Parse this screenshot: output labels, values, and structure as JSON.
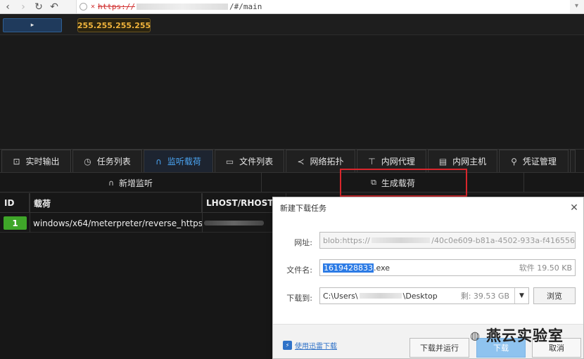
{
  "browser": {
    "back_icon": "chevron-left",
    "forward_icon": "chevron-right",
    "reload_icon": "reload",
    "undo_icon": "undo",
    "add_tab_icon": "plus",
    "warning_icon": "broken-lock",
    "url_scheme": "https://",
    "url_tail": "/#/main"
  },
  "topbar": {
    "play_glyph": "▸",
    "ip": "255.255.255.255"
  },
  "tabs": [
    {
      "label": "实时输出",
      "icon": "terminal-icon",
      "glyph": "⊡"
    },
    {
      "label": "任务列表",
      "icon": "clock-icon",
      "glyph": "◷"
    },
    {
      "label": "监听载荷",
      "icon": "headphones-icon",
      "glyph": "∩",
      "active": true
    },
    {
      "label": "文件列表",
      "icon": "folder-icon",
      "glyph": "▭"
    },
    {
      "label": "网络拓扑",
      "icon": "share-icon",
      "glyph": "≺"
    },
    {
      "label": "内网代理",
      "icon": "proxy-icon",
      "glyph": "⊤"
    },
    {
      "label": "内网主机",
      "icon": "host-icon",
      "glyph": "▤"
    },
    {
      "label": "凭证管理",
      "icon": "search-key-icon",
      "glyph": "⚲"
    }
  ],
  "actions": {
    "new_listener": "新增监听",
    "new_listener_glyph": "∩",
    "generate_payload": "生成载荷",
    "generate_payload_glyph": "⧉"
  },
  "table": {
    "headers": [
      "ID",
      "载荷",
      "LHOST/RHOST"
    ],
    "rows": [
      {
        "id": "1",
        "payload": "windows/x64/meterpreter/reverse_https"
      }
    ]
  },
  "dialog": {
    "title": "新建下载任务",
    "close_glyph": "✕",
    "url_label": "网址:",
    "url_prefix": "blob:https://",
    "url_suffix": "/40c0e609-b81a-4502-933a-f416556",
    "filename_label": "文件名:",
    "filename_selected": "1619428833",
    "filename_ext": ".exe",
    "file_info": "软件 19.50 KB",
    "saveto_label": "下载到:",
    "path_prefix": "C:\\Users\\",
    "path_suffix": "\\Desktop",
    "free_space": "剩: 39.53 GB",
    "browse": "浏览",
    "thunder_link": "使用迅雷下载",
    "btn_download_run": "下载并运行",
    "btn_download": "下载",
    "btn_cancel": "取消"
  },
  "watermark": "燕云实验室"
}
